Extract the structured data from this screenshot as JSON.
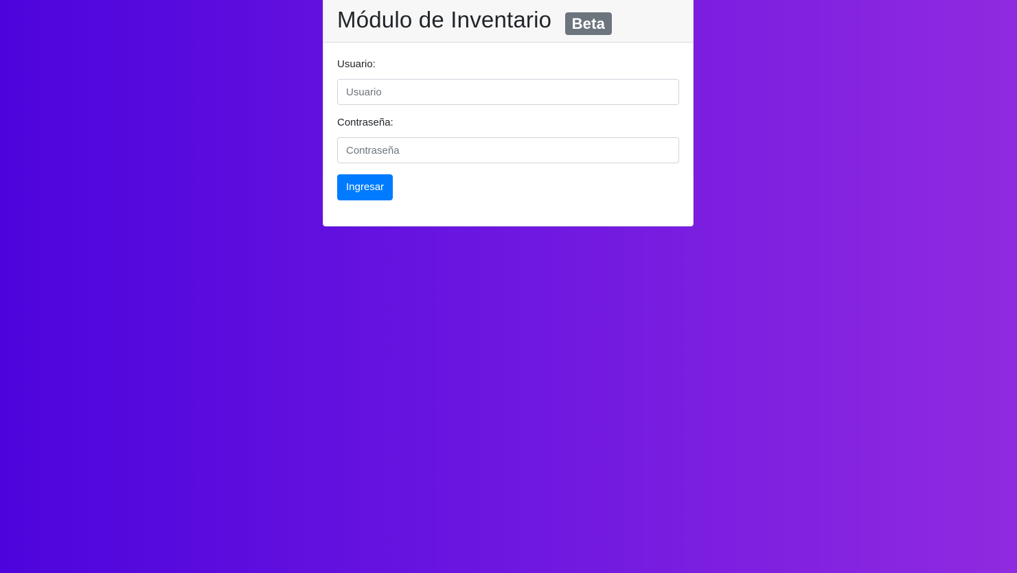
{
  "login": {
    "title": "Módulo de Inventario",
    "badge": "Beta",
    "username": {
      "label": "Usuario:",
      "placeholder": "Usuario",
      "value": ""
    },
    "password": {
      "label": "Contraseña:",
      "placeholder": "Contraseña",
      "value": ""
    },
    "submit_label": "Ingresar"
  },
  "colors": {
    "background_start": "#4d04dc",
    "background_end": "#902ae0",
    "primary_button": "#007bff",
    "badge": "#6c757d",
    "header_bg": "#f7f7f7"
  }
}
